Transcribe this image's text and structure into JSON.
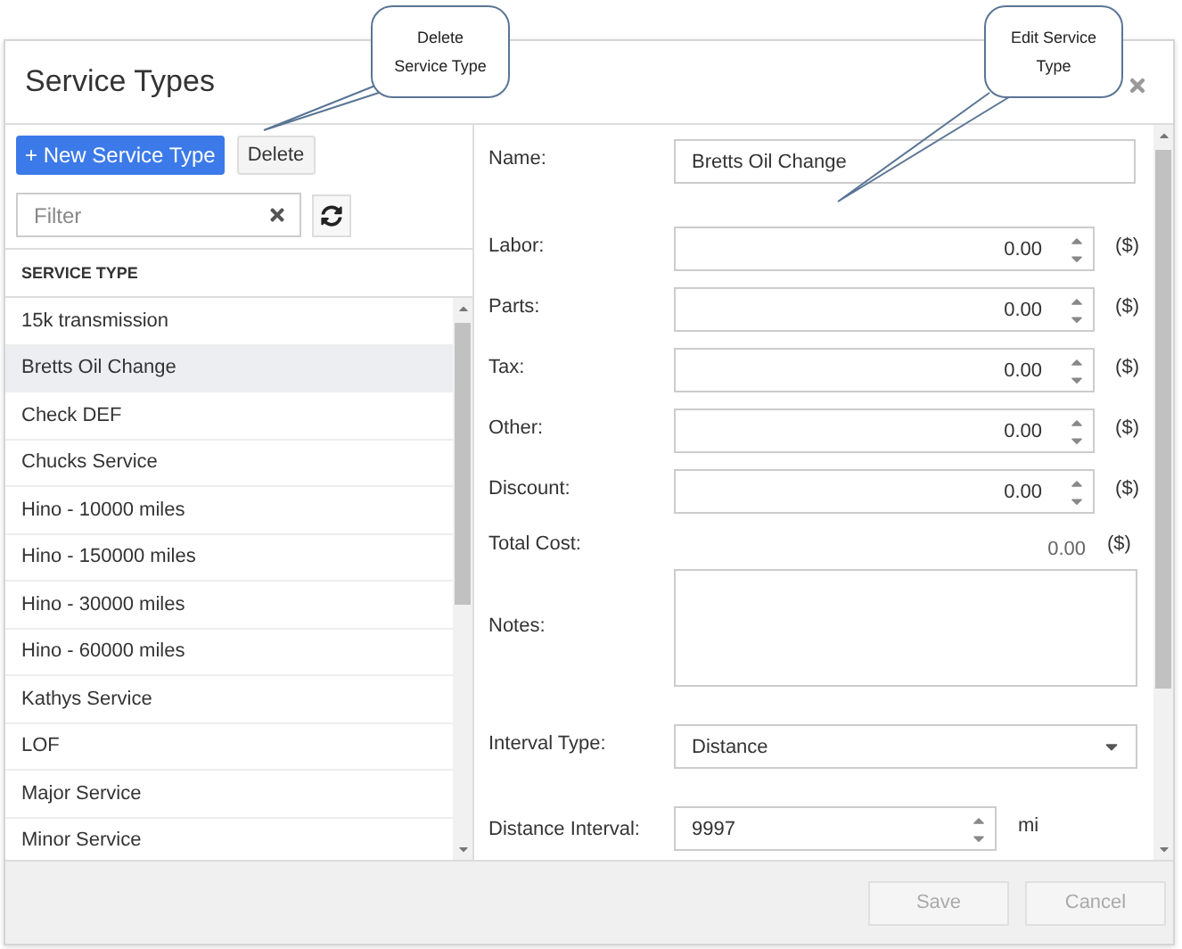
{
  "dialog": {
    "title": "Service Types"
  },
  "toolbar": {
    "new_button": "+ New Service Type",
    "delete_button": "Delete"
  },
  "filter": {
    "placeholder": "Filter"
  },
  "list": {
    "header": "SERVICE TYPE",
    "items": [
      {
        "label": "15k transmission",
        "selected": false
      },
      {
        "label": "Bretts Oil Change",
        "selected": true
      },
      {
        "label": "Check DEF",
        "selected": false
      },
      {
        "label": "Chucks Service",
        "selected": false
      },
      {
        "label": "Hino - 10000 miles",
        "selected": false
      },
      {
        "label": "Hino - 150000 miles",
        "selected": false
      },
      {
        "label": "Hino - 30000 miles",
        "selected": false
      },
      {
        "label": "Hino - 60000 miles",
        "selected": false
      },
      {
        "label": "Kathys Service",
        "selected": false
      },
      {
        "label": "LOF",
        "selected": false
      },
      {
        "label": "Major Service",
        "selected": false
      },
      {
        "label": "Minor Service",
        "selected": false
      }
    ]
  },
  "form": {
    "fields": [
      {
        "kind": "text",
        "label": "Name:",
        "value": "Bretts Oil Change"
      },
      {
        "kind": "number",
        "label": "Labor:",
        "value": "0.00",
        "unit": "($)"
      },
      {
        "kind": "number",
        "label": "Parts:",
        "value": "0.00",
        "unit": "($)"
      },
      {
        "kind": "number",
        "label": "Tax:",
        "value": "0.00",
        "unit": "($)"
      },
      {
        "kind": "number",
        "label": "Other:",
        "value": "0.00",
        "unit": "($)"
      },
      {
        "kind": "number",
        "label": "Discount:",
        "value": "0.00",
        "unit": "($)"
      },
      {
        "kind": "total",
        "label": "Total Cost:",
        "value": "0.00",
        "unit": "($)"
      },
      {
        "kind": "textarea",
        "label": "Notes:"
      },
      {
        "kind": "select",
        "label": "Interval Type:",
        "value": "Distance"
      },
      {
        "kind": "interval",
        "label": "Distance Interval:",
        "value": "9997",
        "unit": "mi"
      }
    ]
  },
  "footer": {
    "buttons": [
      {
        "label": "Save",
        "disabled": true
      },
      {
        "label": "Cancel",
        "disabled": true
      }
    ]
  },
  "callouts": [
    {
      "text": "Delete Service Type"
    },
    {
      "text": "Edit Service Type"
    }
  ]
}
